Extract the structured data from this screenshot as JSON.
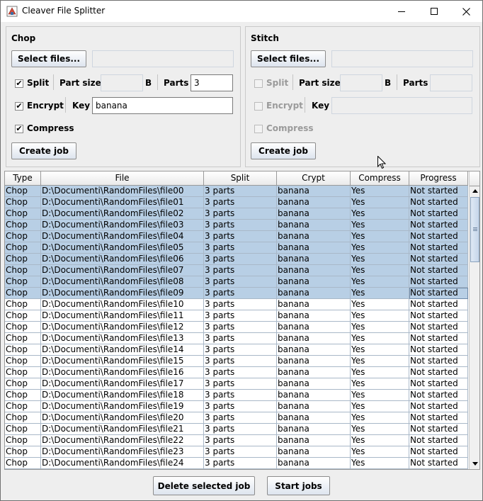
{
  "window": {
    "title": "Cleaver File Splitter"
  },
  "chop": {
    "title": "Chop",
    "select_files_label": "Select files...",
    "files_value": "",
    "split_label": "Split",
    "split_checked": true,
    "part_size_label": "Part size",
    "part_size_value": "",
    "part_size_unit": "B",
    "parts_label": "Parts",
    "parts_value": "3",
    "encrypt_label": "Encrypt",
    "encrypt_checked": true,
    "key_label": "Key",
    "key_value": "banana",
    "compress_label": "Compress",
    "compress_checked": true,
    "create_job_label": "Create job"
  },
  "stitch": {
    "title": "Stitch",
    "select_files_label": "Select files...",
    "files_value": "",
    "split_label": "Split",
    "part_size_label": "Part size",
    "part_size_value": "",
    "part_size_unit": "B",
    "parts_label": "Parts",
    "parts_value": "",
    "encrypt_label": "Encrypt",
    "key_label": "Key",
    "key_value": "",
    "compress_label": "Compress",
    "create_job_label": "Create job"
  },
  "table": {
    "columns": [
      "Type",
      "File",
      "Split",
      "Crypt",
      "Compress",
      "Progress"
    ],
    "selected_rows": 10,
    "rows": [
      [
        "Chop",
        "D:\\Documenti\\RandomFiles\\file00",
        "3 parts",
        "banana",
        "Yes",
        "Not started"
      ],
      [
        "Chop",
        "D:\\Documenti\\RandomFiles\\file01",
        "3 parts",
        "banana",
        "Yes",
        "Not started"
      ],
      [
        "Chop",
        "D:\\Documenti\\RandomFiles\\file02",
        "3 parts",
        "banana",
        "Yes",
        "Not started"
      ],
      [
        "Chop",
        "D:\\Documenti\\RandomFiles\\file03",
        "3 parts",
        "banana",
        "Yes",
        "Not started"
      ],
      [
        "Chop",
        "D:\\Documenti\\RandomFiles\\file04",
        "3 parts",
        "banana",
        "Yes",
        "Not started"
      ],
      [
        "Chop",
        "D:\\Documenti\\RandomFiles\\file05",
        "3 parts",
        "banana",
        "Yes",
        "Not started"
      ],
      [
        "Chop",
        "D:\\Documenti\\RandomFiles\\file06",
        "3 parts",
        "banana",
        "Yes",
        "Not started"
      ],
      [
        "Chop",
        "D:\\Documenti\\RandomFiles\\file07",
        "3 parts",
        "banana",
        "Yes",
        "Not started"
      ],
      [
        "Chop",
        "D:\\Documenti\\RandomFiles\\file08",
        "3 parts",
        "banana",
        "Yes",
        "Not started"
      ],
      [
        "Chop",
        "D:\\Documenti\\RandomFiles\\file09",
        "3 parts",
        "banana",
        "Yes",
        "Not started"
      ],
      [
        "Chop",
        "D:\\Documenti\\RandomFiles\\file10",
        "3 parts",
        "banana",
        "Yes",
        "Not started"
      ],
      [
        "Chop",
        "D:\\Documenti\\RandomFiles\\file11",
        "3 parts",
        "banana",
        "Yes",
        "Not started"
      ],
      [
        "Chop",
        "D:\\Documenti\\RandomFiles\\file12",
        "3 parts",
        "banana",
        "Yes",
        "Not started"
      ],
      [
        "Chop",
        "D:\\Documenti\\RandomFiles\\file13",
        "3 parts",
        "banana",
        "Yes",
        "Not started"
      ],
      [
        "Chop",
        "D:\\Documenti\\RandomFiles\\file14",
        "3 parts",
        "banana",
        "Yes",
        "Not started"
      ],
      [
        "Chop",
        "D:\\Documenti\\RandomFiles\\file15",
        "3 parts",
        "banana",
        "Yes",
        "Not started"
      ],
      [
        "Chop",
        "D:\\Documenti\\RandomFiles\\file16",
        "3 parts",
        "banana",
        "Yes",
        "Not started"
      ],
      [
        "Chop",
        "D:\\Documenti\\RandomFiles\\file17",
        "3 parts",
        "banana",
        "Yes",
        "Not started"
      ],
      [
        "Chop",
        "D:\\Documenti\\RandomFiles\\file18",
        "3 parts",
        "banana",
        "Yes",
        "Not started"
      ],
      [
        "Chop",
        "D:\\Documenti\\RandomFiles\\file19",
        "3 parts",
        "banana",
        "Yes",
        "Not started"
      ],
      [
        "Chop",
        "D:\\Documenti\\RandomFiles\\file20",
        "3 parts",
        "banana",
        "Yes",
        "Not started"
      ],
      [
        "Chop",
        "D:\\Documenti\\RandomFiles\\file21",
        "3 parts",
        "banana",
        "Yes",
        "Not started"
      ],
      [
        "Chop",
        "D:\\Documenti\\RandomFiles\\file22",
        "3 parts",
        "banana",
        "Yes",
        "Not started"
      ],
      [
        "Chop",
        "D:\\Documenti\\RandomFiles\\file23",
        "3 parts",
        "banana",
        "Yes",
        "Not started"
      ],
      [
        "Chop",
        "D:\\Documenti\\RandomFiles\\file24",
        "3 parts",
        "banana",
        "Yes",
        "Not started"
      ]
    ]
  },
  "footer": {
    "delete_label": "Delete selected job",
    "start_label": "Start jobs"
  },
  "colors": {
    "selection": "#b8cfe5",
    "accent": "#3c7fb1"
  }
}
